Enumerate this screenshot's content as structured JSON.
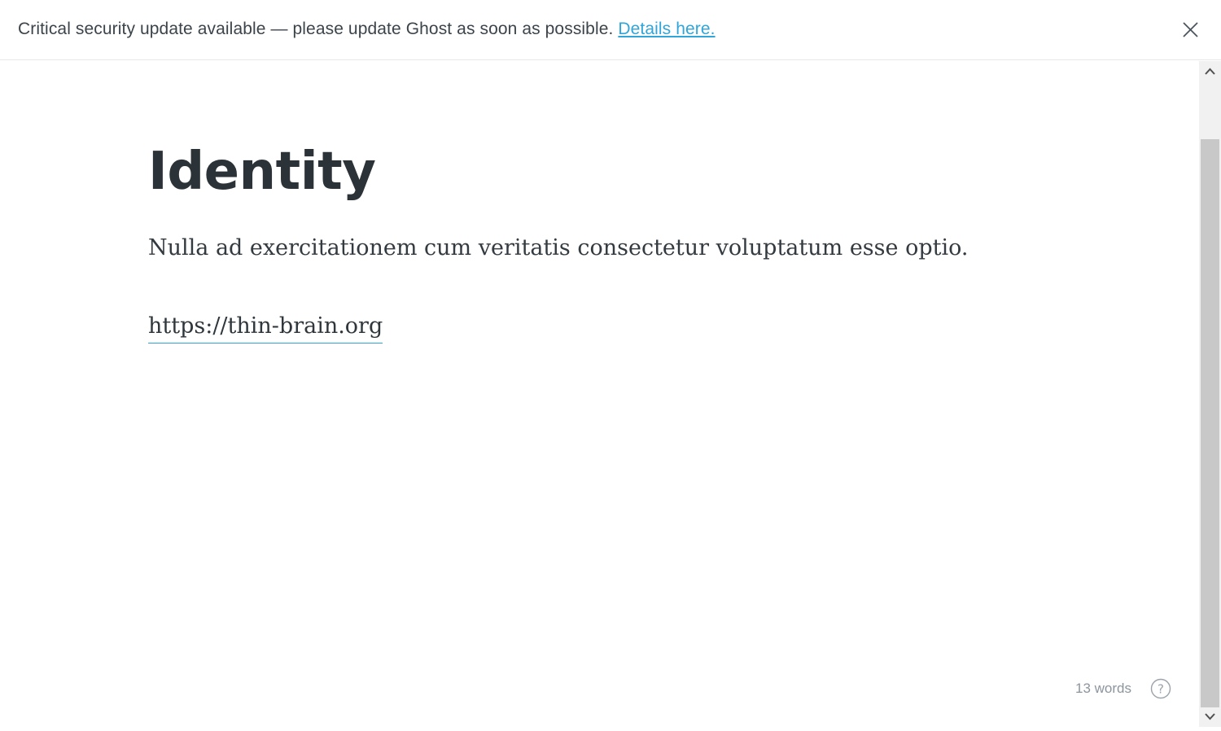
{
  "alert": {
    "message": "Critical security update available — please update Ghost as soon as possible.",
    "link_label": "Details here.",
    "close_icon": "close-icon"
  },
  "editor": {
    "title": "Identity",
    "body": "Nulla ad exercitationem cum veritatis consectetur voluptatum esse optio.",
    "link": "https://thin-brain.org"
  },
  "footer": {
    "word_count": "13 words",
    "help_icon": "help-icon"
  },
  "colors": {
    "accent": "#30a5d9",
    "title": "#2c3338",
    "muted": "#8c959e"
  },
  "scrollbar": {
    "up_icon": "chevron-up-icon",
    "down_icon": "chevron-down-icon"
  }
}
